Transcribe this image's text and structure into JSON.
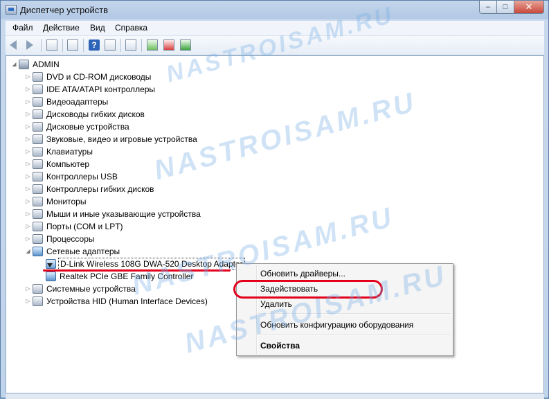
{
  "window": {
    "title": "Диспетчер устройств",
    "buttons": {
      "minimize": "–",
      "maximize": "□",
      "close": "✕"
    }
  },
  "menubar": {
    "items": [
      {
        "label": "Файл"
      },
      {
        "label": "Действие"
      },
      {
        "label": "Вид"
      },
      {
        "label": "Справка"
      }
    ]
  },
  "toolbar": {
    "icons": [
      "back-icon",
      "forward-icon",
      "console-tree-icon",
      "properties-icon",
      "help-icon",
      "view-icon",
      "scan-hardware-icon",
      "update-driver-icon",
      "uninstall-icon",
      "enable-device-icon"
    ]
  },
  "tree": {
    "root": "ADMIN",
    "categories": [
      "DVD и CD-ROM дисководы",
      "IDE ATA/ATAPI контроллеры",
      "Видеоадаптеры",
      "Дисководы гибких дисков",
      "Дисковые устройства",
      "Звуковые, видео и игровые устройства",
      "Клавиатуры",
      "Компьютер",
      "Контроллеры USB",
      "Контроллеры гибких дисков",
      "Мониторы",
      "Мыши и иные указывающие устройства",
      "Порты (COM и LPT)",
      "Процессоры",
      "Сетевые адаптеры"
    ],
    "network_children": [
      "D-Link Wireless 108G DWA-520 Desktop Adapter",
      "Realtek PCIe GBE Family Controller"
    ],
    "after": [
      "Системные устройства",
      "Устройства HID (Human Interface Devices)"
    ]
  },
  "context_menu": {
    "update_drivers": "Обновить драйверы...",
    "enable": "Задействовать",
    "delete": "Удалить",
    "scan_hardware": "Обновить конфигурацию оборудования",
    "properties": "Свойства"
  },
  "watermark": "NASTROISAM.RU",
  "colors": {
    "annotation_red": "#e2001a",
    "title_gradient": "#b2c8e4"
  }
}
